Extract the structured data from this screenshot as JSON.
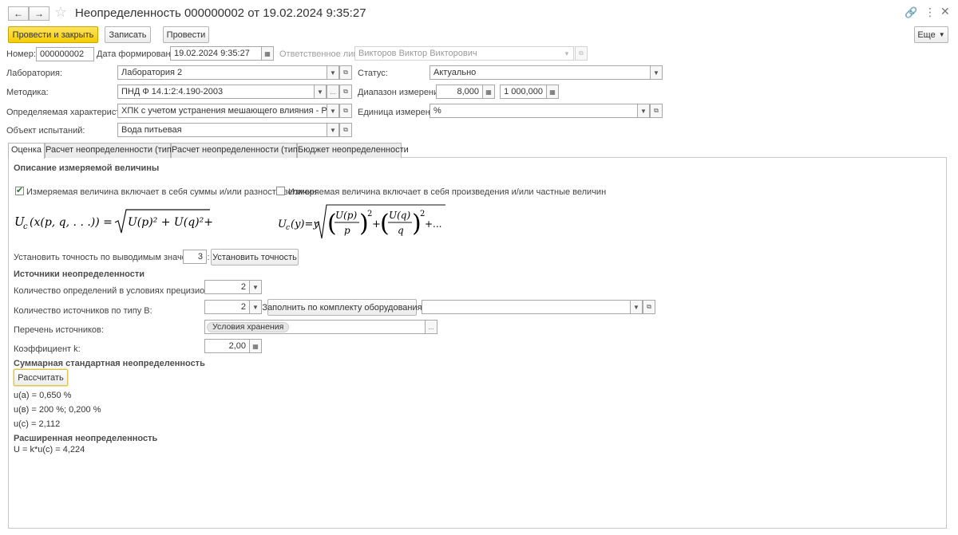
{
  "window": {
    "title": "Неопределенность 000000002 от 19.02.2024 9:35:27",
    "more_label": "Еще"
  },
  "toolbar": {
    "post_close_label": "Провести и закрыть",
    "save_label": "Записать",
    "post_label": "Провести"
  },
  "header": {
    "number_label": "Номер:",
    "number_value": "000000002",
    "date_label": "Дата формирования:",
    "date_value": "19.02.2024  9:35:27",
    "responsible_label": "Ответственное лицо:",
    "responsible_value": "Викторов Виктор Викторович",
    "lab_label": "Лаборатория:",
    "lab_value": "Лаборатория 2",
    "status_label": "Статус:",
    "status_value": "Актуально",
    "method_label": "Методика:",
    "method_value": "ПНД Ф 14.1:2:4.190-2003",
    "range_label": "Диапазон измерений:",
    "range_from": "8,000",
    "range_to": "1 000,000",
    "characteristic_label": "Определяемая характеристика:",
    "characteristic_value": "ХПК с учетом устранения мешающего влияния - Результат",
    "unit_label": "Единица измерения:",
    "unit_value": "%",
    "object_label": "Объект испытаний:",
    "object_value": "Вода питьевая"
  },
  "tabs": [
    {
      "label": "Оценка",
      "active": true
    },
    {
      "label": "Расчет неопределенности (тип А)",
      "active": false
    },
    {
      "label": "Расчет неопределенности (тип В)",
      "active": false
    },
    {
      "label": "Бюджет неопределенности",
      "active": false
    }
  ],
  "evaluation": {
    "measured_title": "Описание измеряемой величины",
    "sum_checkbox_label": "Измеряемая величина включает в себя суммы и/или разности величин",
    "sum_checked": true,
    "product_checkbox_label": "Измеряемая величина включает в себя произведения и/или частные величин",
    "product_checked": false,
    "precision_label": "Установить точность по выводимым значениям:",
    "precision_value": "3",
    "set_precision_button": "Установить точность",
    "sources_title": "Источники неопределенности",
    "repeat_count_label": "Количество определений в условиях прецизионности:",
    "repeat_count_value": "2",
    "typeb_count_label": "Количество источников по типу В:",
    "typeb_count_value": "2",
    "fill_equipment_button": "Заполнить по комплекту оборудования",
    "equipment_value": "",
    "sources_list_label": "Перечень источников:",
    "source_tag": "Условия хранения",
    "coef_label": "Коэффициент k:",
    "coef_value": "2,00",
    "total_title": "Суммарная стандартная неопределенность",
    "calculate_button": "Рассчитать",
    "ua": "u(a) = 0,650 %",
    "ub": "u(в) = 200 %; 0,200 %",
    "uc": "u(c) = 2,112",
    "expanded_title": "Расширенная неопределенность",
    "expanded_value": "U = k*u(c) = 4,224"
  },
  "colors": {
    "primary_button": "#f5cb00",
    "check_mark": "#2c7a2c"
  }
}
